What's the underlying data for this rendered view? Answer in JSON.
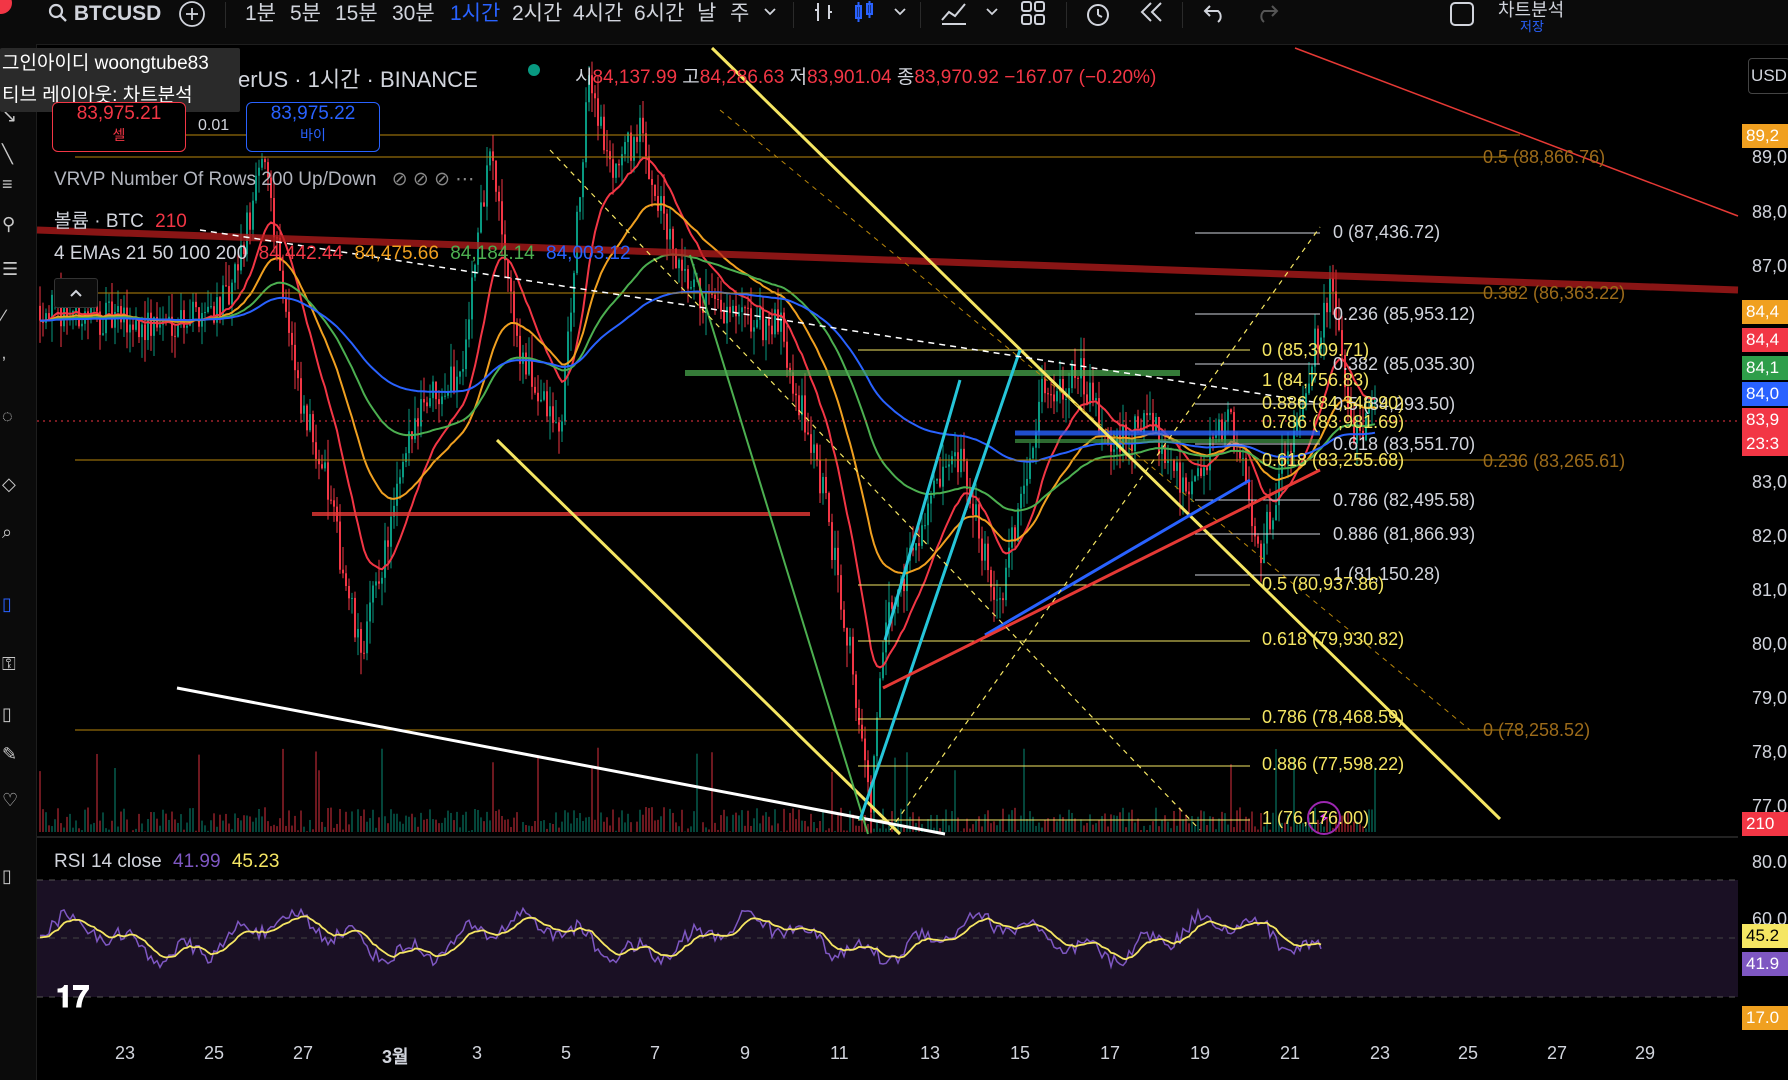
{
  "symbol": "BTCUSD",
  "timeframes": [
    "1분",
    "5분",
    "15분",
    "30분",
    "1시간",
    "2시간",
    "4시간",
    "6시간",
    "날",
    "주"
  ],
  "active_timeframe": "1시간",
  "top_right": {
    "title": "차트분석",
    "save_label": "저장"
  },
  "currency_btn": "USD",
  "tooltip": {
    "line1": "그인아이디 woongtube83",
    "line2": "티브 레이아웃: 차트분석"
  },
  "legend": {
    "symbol_line": "erUS · 1시간 · BINANCE",
    "ohlc": {
      "o_label": "시",
      "o": "84,137.99",
      "h_label": "고",
      "h": "84,286.63",
      "l_label": "저",
      "l": "83,901.04",
      "c_label": "종",
      "c": "83,970.92",
      "change": "−167.07 (−0.20%)"
    },
    "sell_price": "83,975.21",
    "sell_label": "셀",
    "spread": "0.01",
    "buy_price": "83,975.22",
    "buy_label": "바이",
    "vrvp": "VRVP Number Of Rows 200 Up/Down",
    "volume_label": "볼륨 · BTC",
    "volume_value": "210",
    "ema_label": "4 EMAs 21 50 100 200",
    "ema_values": [
      "84,442.44",
      "84,475.66",
      "84,184.14",
      "84,003.12"
    ]
  },
  "rsi": {
    "label": "RSI 14 close",
    "v1": "41.99",
    "v2": "45.23"
  },
  "colors": {
    "accent": "#2962ff",
    "red": "#f23645",
    "green": "#089981",
    "fib_yellow": "#f5e663",
    "fib_orange": "#b8860b",
    "rsi": "#7e57c2"
  },
  "price_axis": [
    "89,0",
    "88,0",
    "87,0",
    "83,0",
    "82,0",
    "81,0",
    "80,0",
    "79,0",
    "78,0",
    "77,0",
    "80.0",
    "60.0"
  ],
  "price_tags": [
    {
      "text": "89,2",
      "color": "#f0a020"
    },
    {
      "text": "84,4",
      "color": "#f0a020"
    },
    {
      "text": "84,4",
      "color": "#f23645"
    },
    {
      "text": "84,1",
      "color": "#2e9e4a"
    },
    {
      "text": "84,0",
      "color": "#2962ff"
    },
    {
      "text": "83,9",
      "color": "#f23645"
    },
    {
      "text": "23:3",
      "color": "#f23645"
    },
    {
      "text": "210",
      "color": "#f23645"
    },
    {
      "text": "45.2",
      "color": "#f5e663"
    },
    {
      "text": "41.9",
      "color": "#7e57c2"
    },
    {
      "text": "17.0",
      "color": "#f0a020"
    }
  ],
  "date_axis": [
    "23",
    "25",
    "27",
    "3월",
    "3",
    "5",
    "7",
    "9",
    "11",
    "13",
    "15",
    "17",
    "19",
    "21",
    "23",
    "25",
    "27",
    "29"
  ],
  "fib_right": [
    "0 (87,436.72)",
    "0.236 (85,953.12)",
    "0.382 (85,035.30)",
    "0.5 (84,293.50)",
    "0.618 (83,551.70)",
    "0.786 (82,495.58)",
    "0.886 (81,866.93)",
    "1 (81,150.28)"
  ],
  "fib_left": [
    "0 (85,309.71)",
    "1 (84,756.83)",
    "0.886 (84,348.90)",
    "0.786 (83,981.69)",
    "0.618 (83,255.68)",
    "0.5 (80,937.86)",
    "0.618 (79,930.82)",
    "0.786 (78,468.59)",
    "0.886 (77,598.22)",
    "1 (76,176.00)"
  ],
  "fib_orange": [
    "0.5 (88,866.76)",
    "0.382 (86,363.22)",
    "0.236 (83,265.61)",
    "0 (78,258.52)"
  ]
}
